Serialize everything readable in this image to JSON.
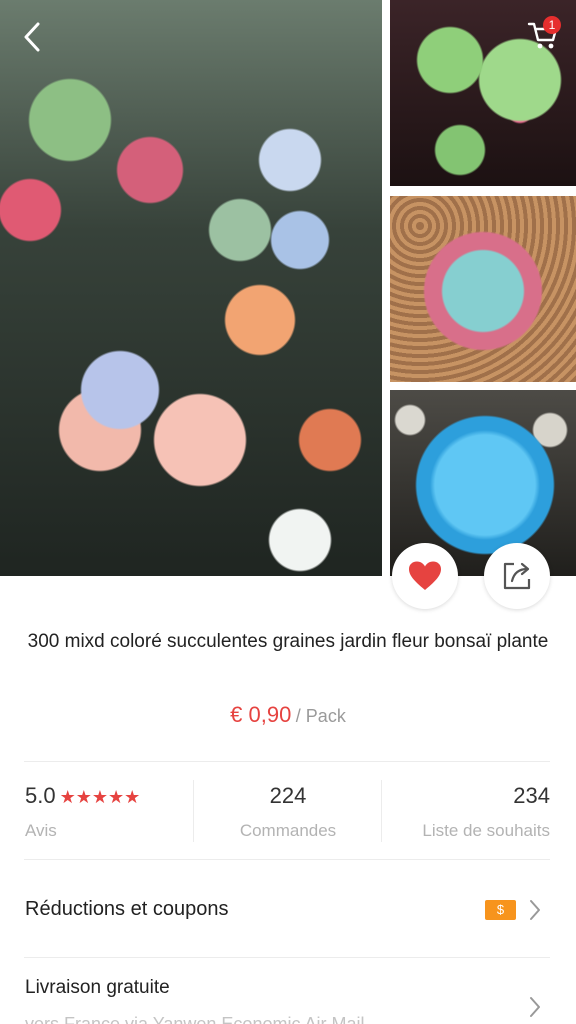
{
  "header": {
    "back_icon": "chevron-left-icon",
    "cart_icon": "shopping-cart-icon",
    "cart_badge": "1"
  },
  "gallery": {
    "images": [
      "succulent-tray-photo",
      "green-pink-succulent-photo",
      "pink-rosette-succulent-photo",
      "blue-succulent-photo"
    ]
  },
  "actions": {
    "like_icon": "heart-icon",
    "share_icon": "share-icon",
    "like_color": "#e64340"
  },
  "product": {
    "title": "300 mixd coloré succulentes graines jardin fleur bonsaï plante",
    "price": "€ 0,90",
    "price_unit": "/ Pack",
    "price_color": "#e64340"
  },
  "stats": {
    "rating_value": "5.0",
    "rating_stars": "★★★★★",
    "rating_label": "Avis",
    "orders_value": "224",
    "orders_label": "Commandes",
    "wishlist_value": "234",
    "wishlist_label": "Liste de souhaits"
  },
  "coupons": {
    "label": "Réductions et coupons",
    "badge": "$",
    "badge_color": "#f7941d"
  },
  "shipping": {
    "label": "Livraison gratuite",
    "subtext": "vers France via Yanwen Economic Air Mail"
  }
}
